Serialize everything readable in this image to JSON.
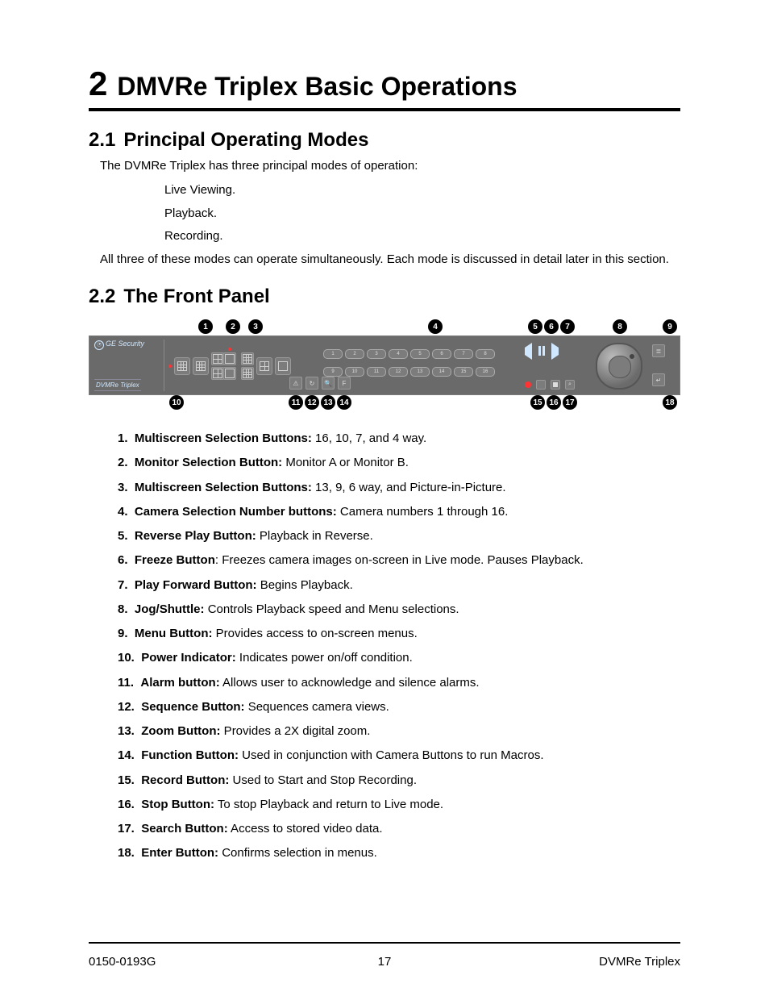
{
  "chapter": {
    "num": "2",
    "title": "DMVRe Triplex Basic Operations"
  },
  "section1": {
    "num": "2.1",
    "title": "Principal Operating Modes",
    "intro": "The DVMRe Triplex has three principal modes of operation:",
    "modes": [
      "Live Viewing.",
      "Playback.",
      "Recording."
    ],
    "closing": "All three of these modes can operate simultaneously.  Each mode is discussed in detail later in this section."
  },
  "section2": {
    "num": "2.2",
    "title": "The Front Panel"
  },
  "panel": {
    "brand": "GE Security",
    "model": "DVMRe Triplex",
    "camera_numbers_top": [
      "1",
      "2",
      "3",
      "4",
      "5",
      "6",
      "7",
      "8"
    ],
    "camera_numbers_bottom": [
      "9",
      "10",
      "11",
      "12",
      "13",
      "14",
      "15",
      "16"
    ],
    "callouts": [
      "1",
      "2",
      "3",
      "4",
      "5",
      "6",
      "7",
      "8",
      "9",
      "10",
      "11",
      "12",
      "13",
      "14",
      "15",
      "16",
      "17",
      "18"
    ]
  },
  "defs": [
    {
      "n": "1.",
      "t": "Multiscreen Selection Buttons:",
      "d": " 16, 10, 7, and 4 way."
    },
    {
      "n": "2.",
      "t": "Monitor Selection Button:",
      "d": " Monitor A or Monitor B."
    },
    {
      "n": "3.",
      "t": "Multiscreen Selection Buttons:",
      "d": " 13, 9, 6 way, and Picture-in-Picture."
    },
    {
      "n": "4.",
      "t": "Camera Selection Number buttons:",
      "d": " Camera numbers 1 through 16."
    },
    {
      "n": "5.",
      "t": "Reverse Play Button:",
      "d": " Playback in Reverse."
    },
    {
      "n": "6.",
      "t": "Freeze Button",
      "d": ": Freezes camera images on-screen in Live mode. Pauses Playback."
    },
    {
      "n": "7.",
      "t": "Play Forward Button:",
      "d": " Begins Playback."
    },
    {
      "n": "8.",
      "t": "Jog/Shuttle:",
      "d": " Controls Playback speed and Menu selections."
    },
    {
      "n": "9.",
      "t": "Menu Button:",
      "d": " Provides access to on-screen menus."
    },
    {
      "n": "10.",
      "t": "Power Indicator:",
      "d": " Indicates power on/off condition."
    },
    {
      "n": "11.",
      "t": "Alarm button:",
      "d": " Allows user to acknowledge and silence alarms."
    },
    {
      "n": "12.",
      "t": "Sequence Button:",
      "d": " Sequences camera views."
    },
    {
      "n": "13.",
      "t": "Zoom Button:",
      "d": " Provides a 2X digital zoom."
    },
    {
      "n": "14.",
      "t": "Function Button:",
      "d": " Used in conjunction with Camera Buttons to run Macros."
    },
    {
      "n": "15.",
      "t": "Record Button:",
      "d": " Used to Start and Stop Recording."
    },
    {
      "n": "16.",
      "t": "Stop Button:",
      "d": " To stop Playback and return to Live mode."
    },
    {
      "n": "17.",
      "t": "Search Button:",
      "d": " Access to stored video data."
    },
    {
      "n": "18.",
      "t": "Enter Button:",
      "d": " Confirms selection in menus."
    }
  ],
  "footer": {
    "left": "0150-0193G",
    "center": "17",
    "right": "DVMRe Triplex"
  }
}
